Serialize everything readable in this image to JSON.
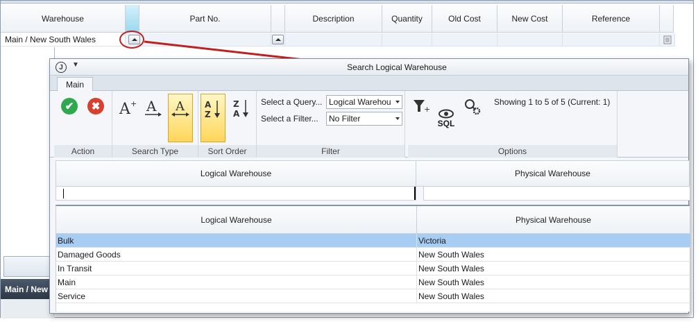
{
  "background_grid": {
    "columns": [
      "Warehouse",
      "Part No.",
      "Description",
      "Quantity",
      "Old Cost",
      "New Cost",
      "Reference"
    ],
    "row": {
      "warehouse": "Main / New South Wales"
    },
    "status_text": "Main / New"
  },
  "dialog": {
    "title": "Search Logical Warehouse",
    "app_icon": "J",
    "tab": "Main",
    "groups": {
      "action": "Action",
      "search_type": "Search Type",
      "sort_order": "Sort Order",
      "filter": "Filter",
      "options": "Options"
    },
    "filter": {
      "query_label": "Select a Query...",
      "query_value": "Logical Warehou",
      "filter_label": "Select a Filter...",
      "filter_value": "No Filter"
    },
    "options": {
      "sql_label": "SQL",
      "showing": "Showing 1 to 5 of 5 (Current: 1)"
    },
    "filter_row_headers": [
      "Logical Warehouse",
      "Physical Warehouse"
    ],
    "results": {
      "headers": [
        "Logical Warehouse",
        "Physical Warehouse"
      ],
      "rows": [
        {
          "logical": "Bulk",
          "physical": "Victoria",
          "selected": true
        },
        {
          "logical": "Damaged Goods",
          "physical": "New South Wales",
          "selected": false
        },
        {
          "logical": "In Transit",
          "physical": "New South Wales",
          "selected": false
        },
        {
          "logical": "Main",
          "physical": "New South Wales",
          "selected": false
        },
        {
          "logical": "Service",
          "physical": "New South Wales",
          "selected": false
        }
      ]
    }
  },
  "colors": {
    "accent_red": "#c0201f",
    "selected_row": "#a8cdf2",
    "ok_green": "#2fa84f",
    "cancel_red": "#d8402e"
  }
}
